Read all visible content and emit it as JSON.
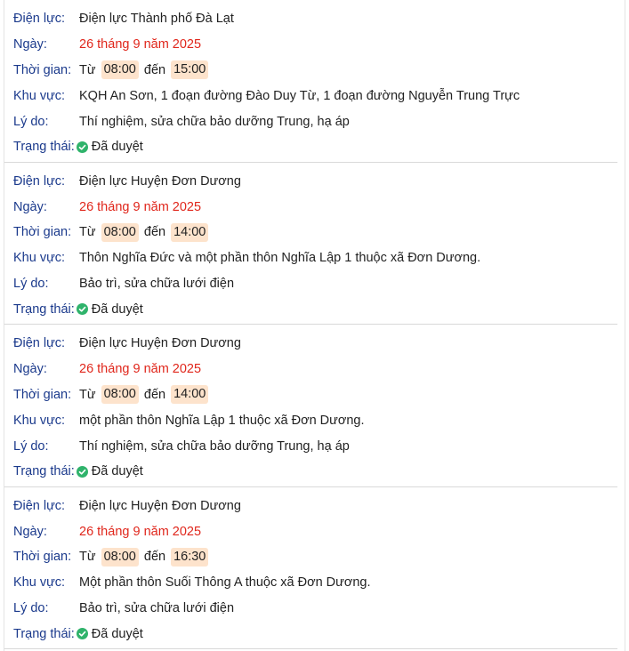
{
  "labels": {
    "dien_luc": "Điện lực:",
    "ngay": "Ngày:",
    "thoi_gian": "Thời gian:",
    "khu_vuc": "Khu vực:",
    "ly_do": "Lý do:",
    "trang_thai": "Trạng thái:",
    "tu": "Từ",
    "den": "đến"
  },
  "colors": {
    "label": "#1b3a8c",
    "date": "#e0261b",
    "time_chip_bg": "#fde3cc",
    "status_check": "#2fb36b"
  },
  "records": [
    {
      "dien_luc": "Điện lực Thành phố Đà Lạt",
      "ngay": "26 tháng 9 năm 2025",
      "start": "08:00",
      "end": "15:00",
      "khu_vuc": "KQH An Sơn, 1 đoạn đường Đào Duy Từ, 1 đoạn đường Nguyễn Trung Trực",
      "ly_do": "Thí nghiệm, sửa chữa bảo dưỡng Trung, hạ áp",
      "trang_thai": "Đã duyệt"
    },
    {
      "dien_luc": "Điện lực Huyện Đơn Dương",
      "ngay": "26 tháng 9 năm 2025",
      "start": "08:00",
      "end": "14:00",
      "khu_vuc": "Thôn Nghĩa Đức và một phần thôn Nghĩa Lập 1 thuộc xã Đơn Dương.",
      "ly_do": "Bảo trì, sửa chữa lưới điện",
      "trang_thai": "Đã duyệt"
    },
    {
      "dien_luc": "Điện lực Huyện Đơn Dương",
      "ngay": "26 tháng 9 năm 2025",
      "start": "08:00",
      "end": "14:00",
      "khu_vuc": "một phần thôn Nghĩa Lập 1 thuộc xã Đơn Dương.",
      "ly_do": "Thí nghiệm, sửa chữa bảo dưỡng Trung, hạ áp",
      "trang_thai": "Đã duyệt"
    },
    {
      "dien_luc": "Điện lực Huyện Đơn Dương",
      "ngay": "26 tháng 9 năm 2025",
      "start": "08:00",
      "end": "16:30",
      "khu_vuc": "Một phần thôn Suối Thông A thuộc xã Đơn Dương.",
      "ly_do": "Bảo trì, sửa chữa lưới điện",
      "trang_thai": "Đã duyệt"
    }
  ]
}
